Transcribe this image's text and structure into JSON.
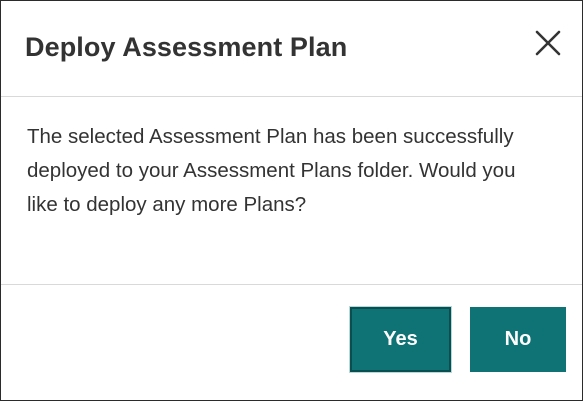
{
  "dialog": {
    "title": "Deploy Assessment Plan",
    "close_icon": "close-icon",
    "message": "The selected Assessment Plan has been successfully deployed to your Assessment Plans folder. Would you like to deploy any more Plans?",
    "buttons": {
      "yes_label": "Yes",
      "no_label": "No"
    }
  },
  "colors": {
    "button_background": "#0f7375",
    "button_text": "#ffffff",
    "title_text": "#333333",
    "divider": "#d9d9d9"
  }
}
